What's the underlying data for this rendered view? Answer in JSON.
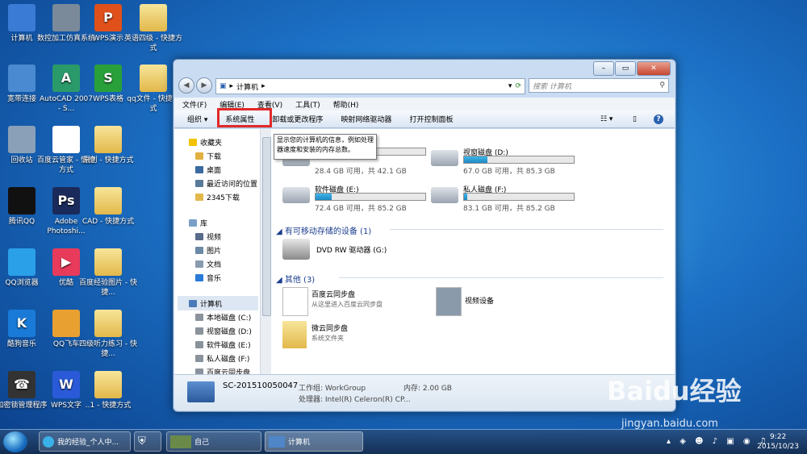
{
  "desktop": {
    "icons": [
      {
        "label": "计算机"
      },
      {
        "label": "数控加工仿真系统"
      },
      {
        "label": "WPS演示"
      },
      {
        "label": "英语四级 - 快捷方式"
      },
      {
        "label": "宽带连接"
      },
      {
        "label": "AutoCAD 2007 - S..."
      },
      {
        "label": "WPS表格"
      },
      {
        "label": "qq文件 - 快捷方式"
      },
      {
        "label": "回收站"
      },
      {
        "label": "百度云管家 - 快捷方式"
      },
      {
        "label": "原创 - 快捷方式"
      },
      {
        "label": "腾讯QQ"
      },
      {
        "label": "Adobe Photoshi..."
      },
      {
        "label": "CAD - 快捷方式"
      },
      {
        "label": "QQ浏览器"
      },
      {
        "label": "优酷"
      },
      {
        "label": "百度经验图片 - 快捷..."
      },
      {
        "label": "酷狗音乐"
      },
      {
        "label": "QQ飞车"
      },
      {
        "label": "四级听力练习 - 快捷..."
      },
      {
        "label": "加密锁管理程序"
      },
      {
        "label": "WPS文字"
      },
      {
        "label": "..1 - 快捷方式"
      }
    ]
  },
  "window": {
    "address": "计算机",
    "search_placeholder": "搜索 计算机",
    "menu": [
      "文件(F)",
      "编辑(E)",
      "查看(V)",
      "工具(T)",
      "帮助(H)"
    ],
    "toolbar": [
      "组织 ▾",
      "系统属性",
      "卸载或更改程序",
      "映射网络驱动器",
      "打开控制面板"
    ],
    "tooltip": "显示您的计算机的信息，例如处理器速度和安装的内存总数。",
    "nav": {
      "favorites": "收藏夹",
      "fav_items": [
        "下载",
        "桌面",
        "最近访问的位置",
        "2345下载"
      ],
      "library": "库",
      "lib_items": [
        "视频",
        "图片",
        "文档",
        "音乐"
      ],
      "computer": "计算机",
      "comp_items": [
        "本地磁盘 (C:)",
        "视窗磁盘 (D:)",
        "软件磁盘 (E:)",
        "私人磁盘 (F:)",
        "百度云同步盘"
      ]
    },
    "drives": [
      {
        "name": "",
        "capacity": "28.4 GB 可用，共 42.1 GB",
        "used": 0.33
      },
      {
        "name": "视窗磁盘 (D:)",
        "capacity": "67.0 GB 可用，共 85.3 GB",
        "used": 0.21
      },
      {
        "name": "软件磁盘 (E:)",
        "capacity": "72.4 GB 可用，共 85.2 GB",
        "used": 0.15
      },
      {
        "name": "私人磁盘 (F:)",
        "capacity": "83.1 GB 可用，共 85.2 GB",
        "used": 0.03
      }
    ],
    "removable": {
      "header": "有可移动存储的设备 (1)",
      "item": "DVD RW 驱动器 (G:)"
    },
    "other": {
      "header": "其他 (3)",
      "items": [
        {
          "name": "百度云同步盘",
          "desc": "从这里进入百度云同步盘"
        },
        {
          "name": "视频设备",
          "desc": ""
        },
        {
          "name": "微云同步盘",
          "desc": "系统文件夹"
        }
      ]
    },
    "status": {
      "computer_name": "SC-201510050047",
      "workgroup": "工作组: WorkGroup",
      "memory": "内存: 2.00 GB",
      "processor": "处理器: Intel(R) Celeron(R) CP..."
    }
  },
  "taskbar": {
    "tasks": [
      "我的经验_个人中...",
      "自己",
      "计算机"
    ],
    "time": "9:22",
    "date": "2015/10/23"
  },
  "watermark": {
    "logo": "Baidu经验",
    "url": "jingyan.baidu.com"
  }
}
